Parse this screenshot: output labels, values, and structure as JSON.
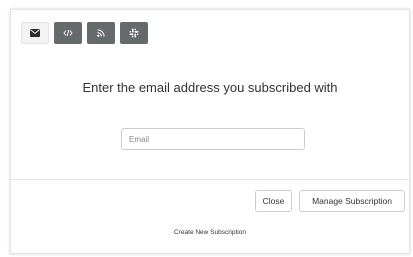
{
  "tabs": [
    {
      "icon": "envelope-icon",
      "active": true
    },
    {
      "icon": "code-icon",
      "active": false
    },
    {
      "icon": "rss-icon",
      "active": false
    },
    {
      "icon": "slack-icon",
      "active": false
    }
  ],
  "headline": "Enter the email address you subscribed with",
  "email_field": {
    "placeholder": "Email",
    "value": ""
  },
  "buttons": {
    "close_label": "Close",
    "manage_label": "Manage Subscription"
  },
  "create_link": "Create New Subscription",
  "colors": {
    "tab_dark": "#646b6a",
    "tab_active": "#f3f3f3",
    "text": "#333333",
    "border": "#cccccc"
  }
}
